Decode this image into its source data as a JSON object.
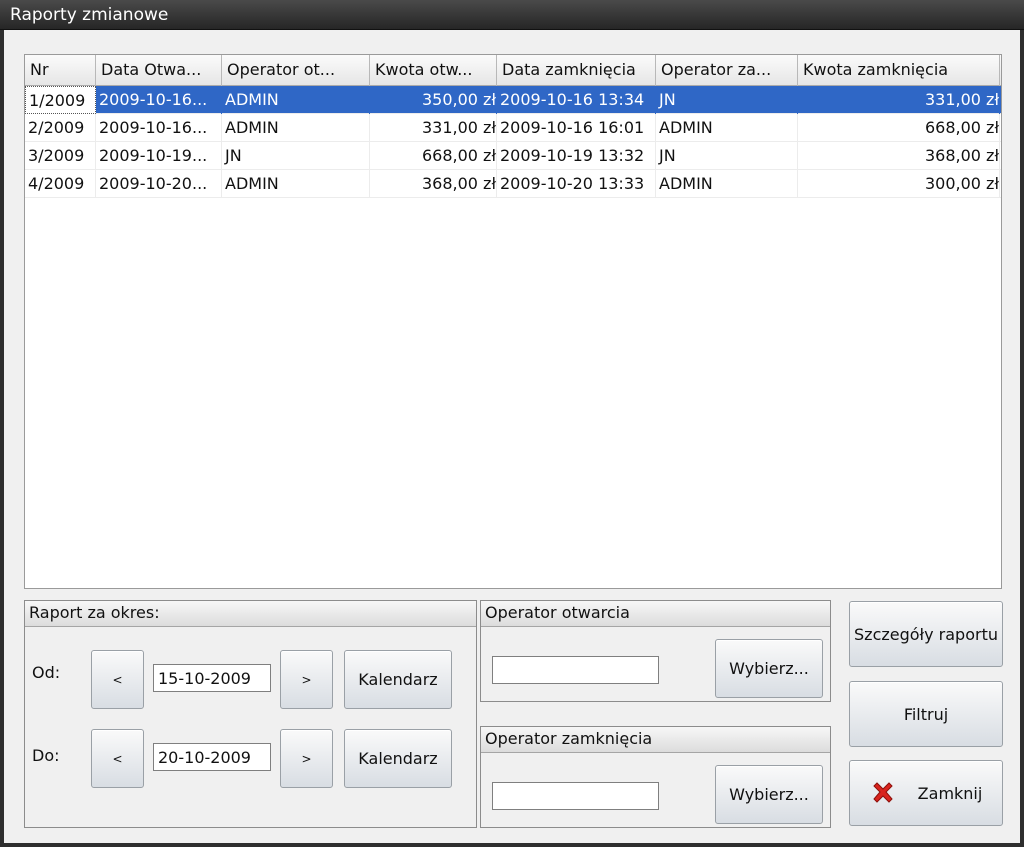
{
  "window": {
    "title": "Raporty zmianowe"
  },
  "table": {
    "columns": [
      "Nr",
      "Data Otwa...",
      "Operator ot...",
      "Kwota otw...",
      "Data zamknięcia",
      "Operator za...",
      "Kwota zamknięcia"
    ],
    "rows": [
      {
        "nr": "1/2009",
        "data_otw": "2009-10-16...",
        "op_otw": "ADMIN",
        "kwota_otw": "350,00 zł",
        "data_zam": "2009-10-16 13:34",
        "op_zam": "JN",
        "kwota_zam": "331,00 zł",
        "selected": true
      },
      {
        "nr": "2/2009",
        "data_otw": "2009-10-16...",
        "op_otw": "ADMIN",
        "kwota_otw": "331,00 zł",
        "data_zam": "2009-10-16 16:01",
        "op_zam": "ADMIN",
        "kwota_zam": "668,00 zł"
      },
      {
        "nr": "3/2009",
        "data_otw": "2009-10-19...",
        "op_otw": "JN",
        "kwota_otw": "668,00 zł",
        "data_zam": "2009-10-19 13:32",
        "op_zam": "JN",
        "kwota_zam": "368,00 zł"
      },
      {
        "nr": "4/2009",
        "data_otw": "2009-10-20...",
        "op_otw": "ADMIN",
        "kwota_otw": "368,00 zł",
        "data_zam": "2009-10-20 13:33",
        "op_zam": "ADMIN",
        "kwota_zam": "300,00 zł"
      }
    ]
  },
  "period": {
    "title": "Raport za okres:",
    "from_label": "Od:",
    "to_label": "Do:",
    "prev_label": "<",
    "next_label": ">",
    "from_value": "15-10-2009",
    "to_value": "20-10-2009",
    "calendar_label": "Kalendarz"
  },
  "operator_open": {
    "title": "Operator otwarcia",
    "value": "",
    "choose_label": "Wybierz..."
  },
  "operator_close": {
    "title": "Operator zamknięcia",
    "value": "",
    "choose_label": "Wybierz..."
  },
  "actions": {
    "details_label": "Szczegóły raportu",
    "filter_label": "Filtruj",
    "close_label": "Zamknij",
    "close_icon": "red-x-icon"
  },
  "colors": {
    "selection": "#2f67c6",
    "close_icon": "#d9231d"
  }
}
